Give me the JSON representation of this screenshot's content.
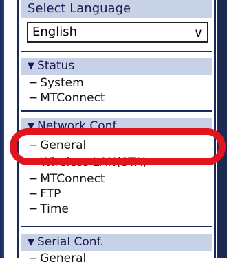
{
  "language": {
    "header": "Select Language",
    "selected": "English"
  },
  "status": {
    "header": "Status",
    "items": [
      "System",
      "MTConnect"
    ]
  },
  "network": {
    "header": "Network Conf.",
    "items": [
      "General",
      "Wireless LAN(STA)",
      "MTConnect",
      "FTP",
      "Time"
    ]
  },
  "serial": {
    "header": "Serial Conf.",
    "items": [
      "General"
    ]
  },
  "colors": {
    "header_bg": "#c7d2e6",
    "frame": "#1a2a5a",
    "highlight": "#e0151e"
  }
}
